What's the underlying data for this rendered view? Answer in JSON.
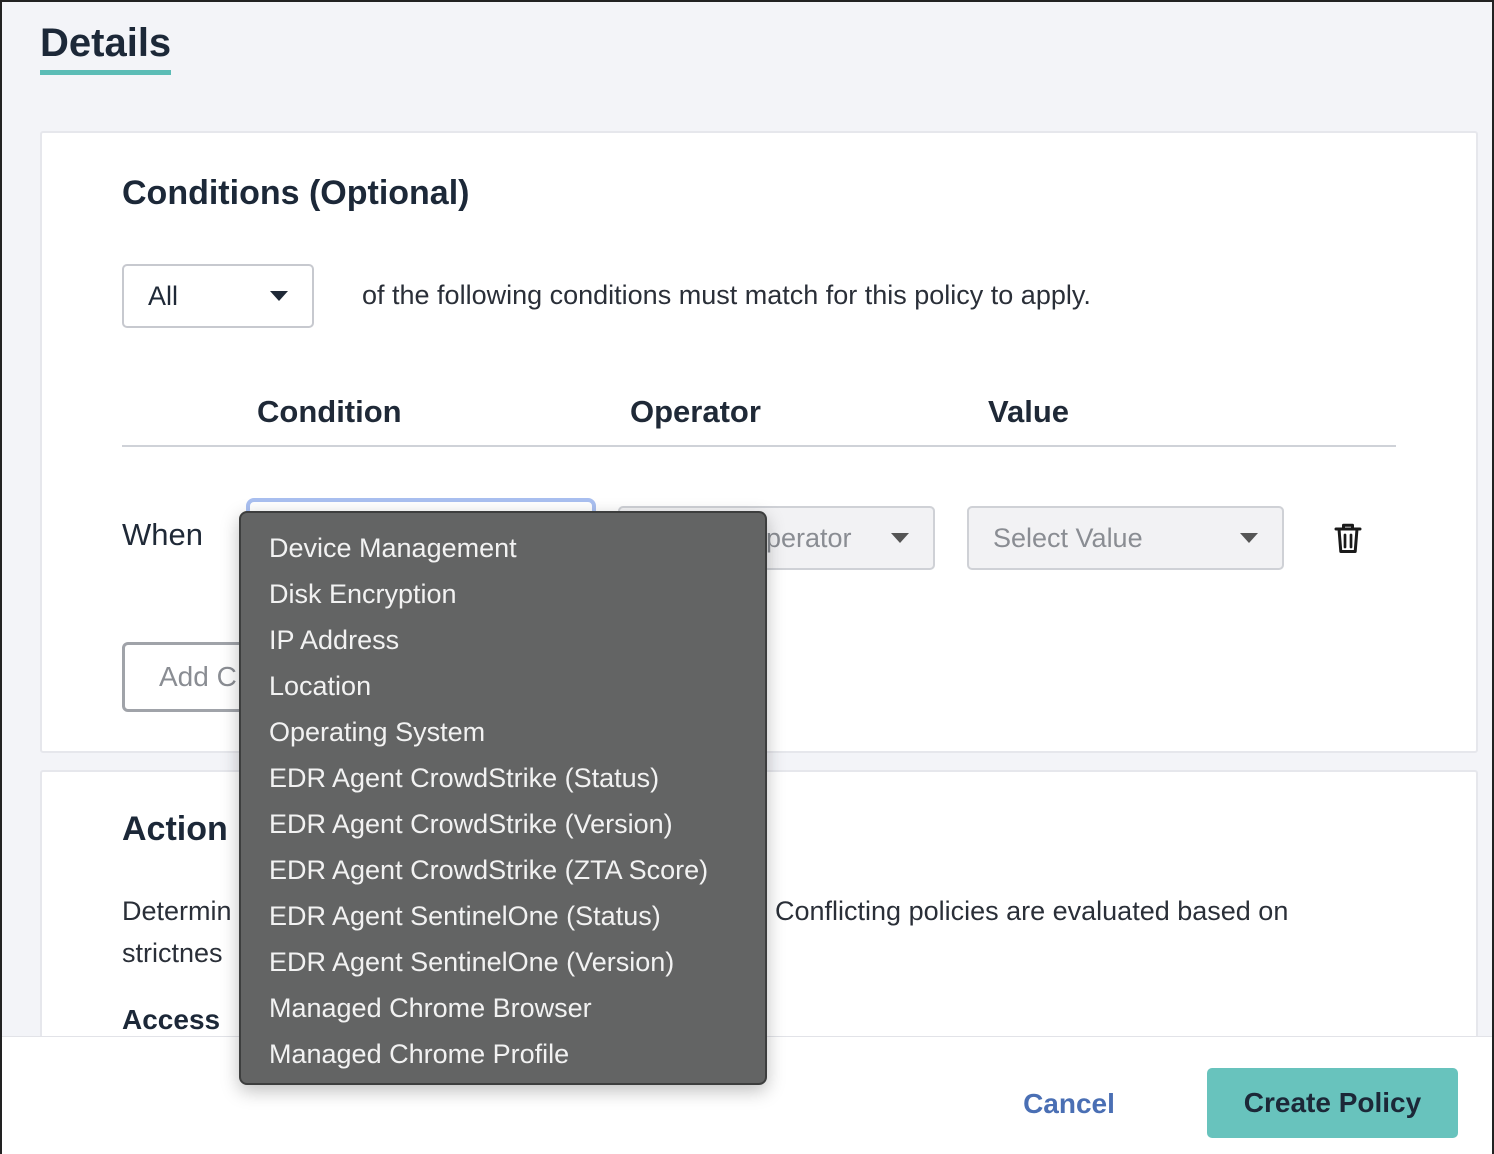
{
  "page": {
    "title": "Details"
  },
  "conditions": {
    "title": "Conditions (Optional)",
    "match_select": {
      "value": "All"
    },
    "match_text": "of the following conditions must match for this policy to apply.",
    "columns": [
      "Condition",
      "Operator",
      "Value"
    ],
    "row": {
      "when_label": "When",
      "operator_placeholder": "perator",
      "value_placeholder": "Select Value",
      "delete_icon": "trash-icon"
    },
    "add_button_label": "Add C"
  },
  "condition_dropdown": {
    "items": [
      "Device Management",
      "Disk Encryption",
      "IP Address",
      "Location",
      "Operating System",
      "EDR Agent CrowdStrike (Status)",
      "EDR Agent CrowdStrike (Version)",
      "EDR Agent CrowdStrike (ZTA Score)",
      "EDR Agent SentinelOne (Status)",
      "EDR Agent SentinelOne (Version)",
      "Managed Chrome Browser",
      "Managed Chrome Profile"
    ]
  },
  "action": {
    "title": "Action",
    "desc_line1_left": "Determin",
    "desc_line1_right": "Conflicting policies are evaluated based on",
    "desc_line2": "strictnes",
    "access_label": "Access"
  },
  "footer": {
    "cancel_label": "Cancel",
    "create_label": "Create Policy"
  },
  "colors": {
    "accent_teal": "#68c3bd",
    "title_underline": "#5bbcb6",
    "link_blue": "#4a6fb4",
    "focus_ring": "#a9bff0",
    "dropdown_bg": "#636464"
  }
}
